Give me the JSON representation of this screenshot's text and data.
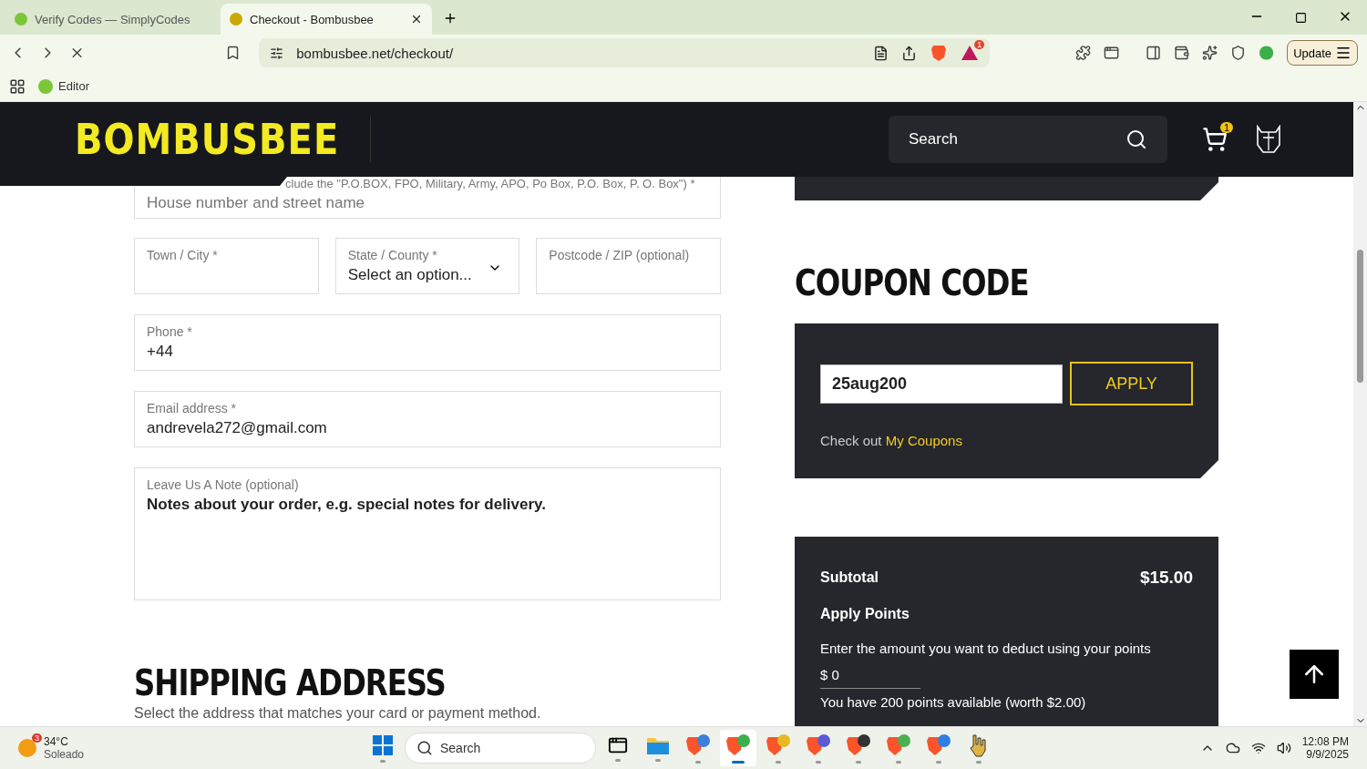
{
  "browser": {
    "tabs": [
      {
        "title": "Verify Codes — SimplyCodes",
        "selected": false
      },
      {
        "title": "Checkout - Bombusbee",
        "selected": true
      }
    ],
    "address": "bombusbee.net/checkout/",
    "alert_count": "1",
    "update_button": "Update",
    "bookmarks": [
      {
        "label": "Editor"
      }
    ]
  },
  "site_header": {
    "logo": "BOMBUSBEE",
    "search_placeholder": "Search",
    "cart_count": "1"
  },
  "billing": {
    "address_hint": "clude the \"P.O.BOX, FPO, Military, Army, APO, Po Box, P.O. Box, P. O. Box\") *",
    "address_placeholder": "House number and street name",
    "city_row": [
      {
        "kind": "text",
        "label": "Town / City *"
      },
      {
        "kind": "select",
        "label": "State / County *",
        "value": "Select an option..."
      },
      {
        "kind": "text",
        "label": "Postcode / ZIP (optional)"
      }
    ],
    "fields": [
      {
        "kind": "text",
        "label": "Phone *",
        "value": "+44"
      },
      {
        "kind": "text",
        "label": "Email address *",
        "value": "andrevela272@gmail.com"
      },
      {
        "kind": "textarea",
        "label": "Leave Us A Note (optional)",
        "placeholder": "Notes about your order, e.g. special notes for delivery."
      }
    ]
  },
  "shipping": {
    "heading": "SHIPPING ADDRESS",
    "text": "Select the address that matches your card or payment method."
  },
  "coupon": {
    "heading": "COUPON CODE",
    "value": "25aug200",
    "button": "APPLY",
    "hint": "Check out",
    "link": "My Coupons"
  },
  "totals": {
    "subtotal_label": "Subtotal",
    "subtotal_value": "$15.00",
    "points_heading": "Apply Points",
    "points_prompt": "Enter the amount you want to deduct using your points",
    "points_value": "$ 0",
    "points_available": "You have 200 points available (worth $2.00)"
  },
  "taskbar": {
    "weather_badge": "3",
    "temperature": "34°C",
    "condition": "Soleado",
    "search_placeholder": "Search",
    "time": "12:08 PM",
    "date": "9/9/2025",
    "apps": [
      {
        "kind": "windows",
        "selected": false
      },
      {
        "kind": "widget",
        "selected": false
      },
      {
        "kind": "folder",
        "selected": false
      },
      {
        "kind": "brave",
        "color": "#3b7fd9",
        "selected": false
      },
      {
        "kind": "brave",
        "color": "#3bb04a",
        "selected": true
      },
      {
        "kind": "brave",
        "color": "#e8b923",
        "selected": false
      },
      {
        "kind": "brave",
        "color": "#5b5bd6",
        "selected": false
      },
      {
        "kind": "brave",
        "color": "#333333",
        "selected": false
      },
      {
        "kind": "brave",
        "color": "#4caf50",
        "selected": false
      },
      {
        "kind": "brave",
        "color": "#2f7fe0",
        "selected": false
      },
      {
        "kind": "hand",
        "selected": false
      }
    ]
  }
}
